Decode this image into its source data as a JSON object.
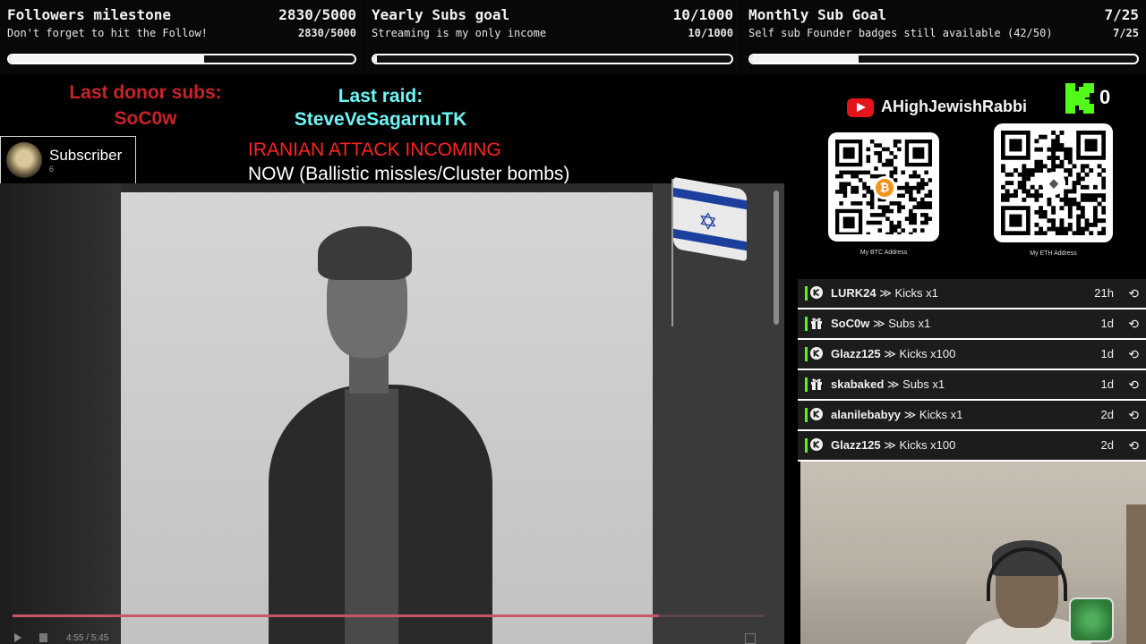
{
  "goals": [
    {
      "title": "Followers milestone",
      "count": "2830/5000",
      "subtitle": "Don't forget to hit the Follow!",
      "subcount": "2830/5000",
      "progress": 0.566
    },
    {
      "title": "Yearly Subs goal",
      "count": "10/1000",
      "subtitle": "Streaming is my only income",
      "subcount": "10/1000",
      "progress": 0.01
    },
    {
      "title": "Monthly Sub Goal",
      "count": "7/25",
      "subtitle": "Self sub Founder badges still available (42/50)",
      "subcount": "7/25",
      "progress": 0.28
    }
  ],
  "donor": {
    "label": "Last donor subs:",
    "name": "SoC0w"
  },
  "raid": {
    "label": "Last raid:",
    "name": "SteveVeSagarnuTK"
  },
  "alert": {
    "line1": "IRANIAN ATTACK INCOMING",
    "line2": "NOW (Ballistic missles/Cluster bombs)"
  },
  "subscriber_badge": {
    "label": "Subscriber",
    "count": "6"
  },
  "video": {
    "time": "4:55 / 5:45",
    "progress": 0.86
  },
  "channel": {
    "handle": "AHighJewishRabbi",
    "kick_count": "0"
  },
  "qr": {
    "btc_caption": "My BTC Address",
    "eth_caption": "My ETH Address"
  },
  "feed": [
    {
      "icon": "kick-icon",
      "user": "LURK24",
      "action": "Kicks x1",
      "time": "21h"
    },
    {
      "icon": "gift-icon",
      "user": "SoC0w",
      "action": "Subs x1",
      "time": "1d"
    },
    {
      "icon": "kick-icon",
      "user": "Glazz125",
      "action": "Kicks x100",
      "time": "1d"
    },
    {
      "icon": "gift-icon",
      "user": "skabaked",
      "action": "Subs x1",
      "time": "1d"
    },
    {
      "icon": "kick-icon",
      "user": "alanilebabyy",
      "action": "Kicks x1",
      "time": "2d"
    },
    {
      "icon": "kick-icon",
      "user": "Glazz125",
      "action": "Kicks x100",
      "time": "2d"
    }
  ],
  "feed_separator": "≫",
  "colors": {
    "kick_green": "#53fc18",
    "donor_red": "#c8232b",
    "raid_cyan": "#6ff4f4",
    "alert_red": "#ff2222",
    "youtube_red": "#e5141b"
  }
}
